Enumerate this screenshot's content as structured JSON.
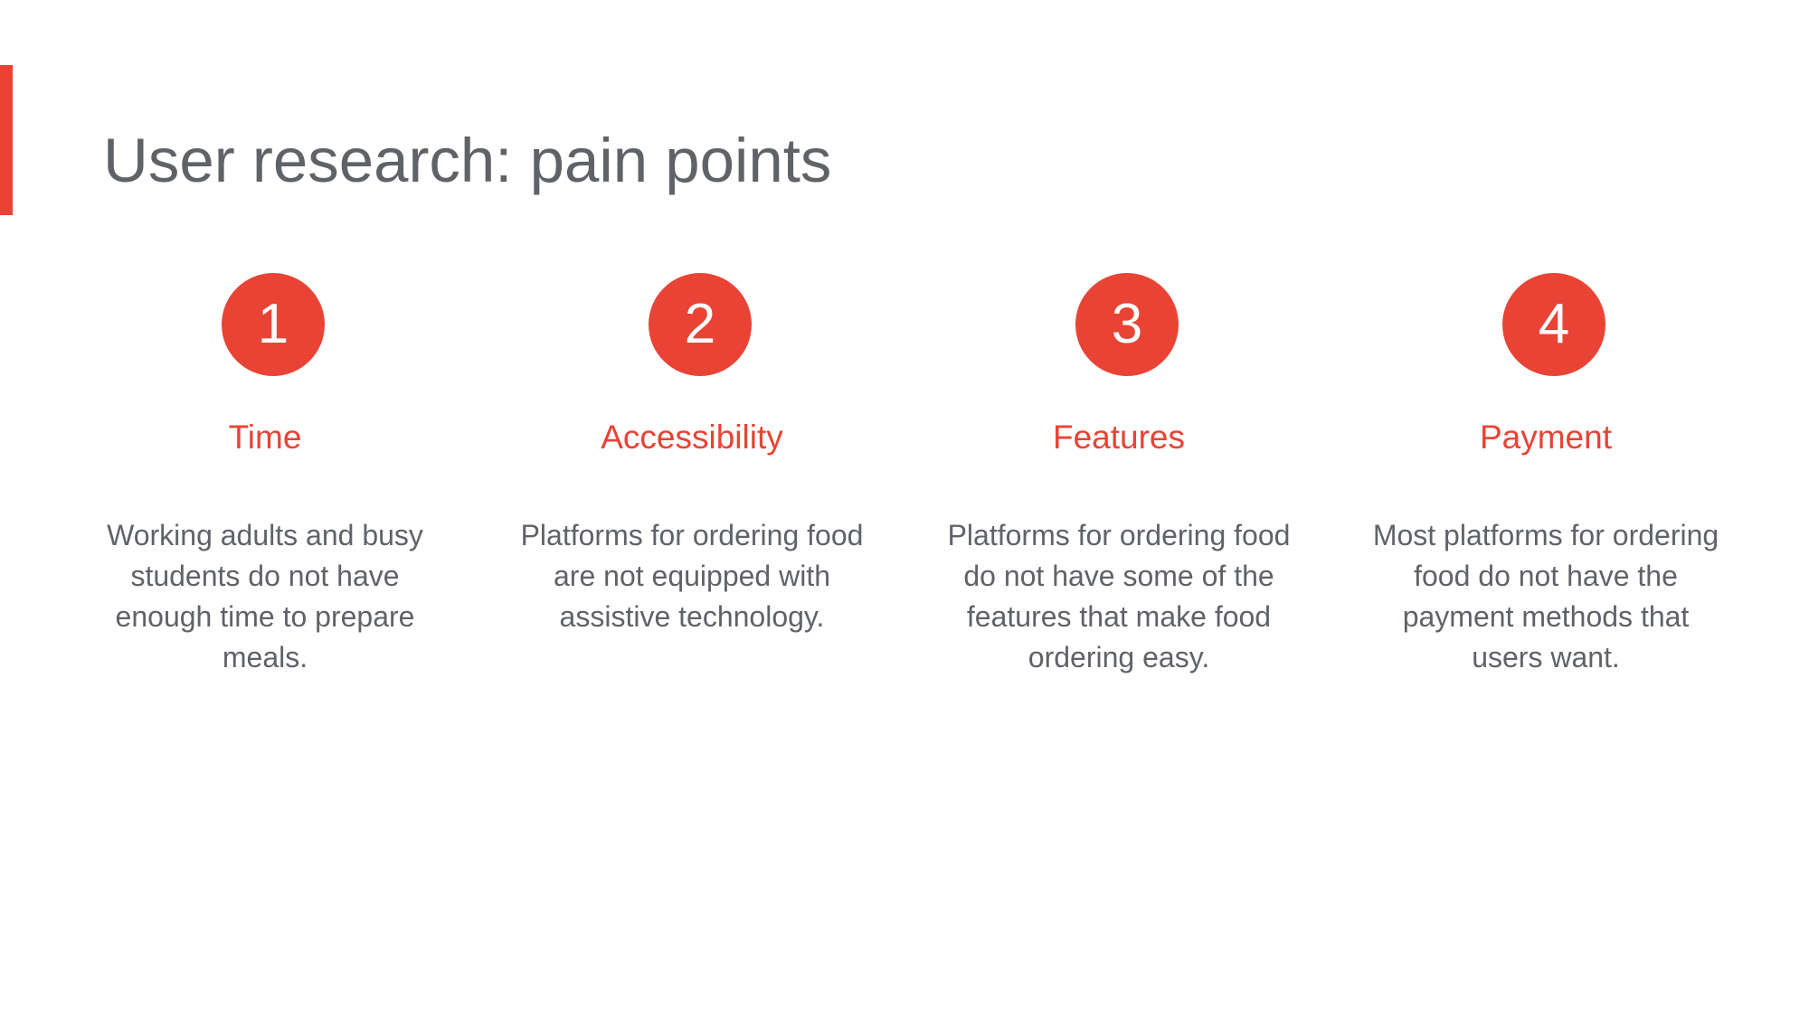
{
  "slide": {
    "title": "User research: pain points",
    "accent_color": "#e94335",
    "text_color": "#5f6368"
  },
  "pain_points": [
    {
      "number": "1",
      "heading": "Time",
      "description": "Working adults and busy students do not have enough time to prepare meals."
    },
    {
      "number": "2",
      "heading": "Accessibility",
      "description": "Platforms for ordering food are not equipped with assistive technology."
    },
    {
      "number": "3",
      "heading": "Features",
      "description": "Platforms for ordering food do not have some of the features that make food ordering easy."
    },
    {
      "number": "4",
      "heading": "Payment",
      "description": "Most platforms for ordering food do not have the payment methods that users want."
    }
  ]
}
